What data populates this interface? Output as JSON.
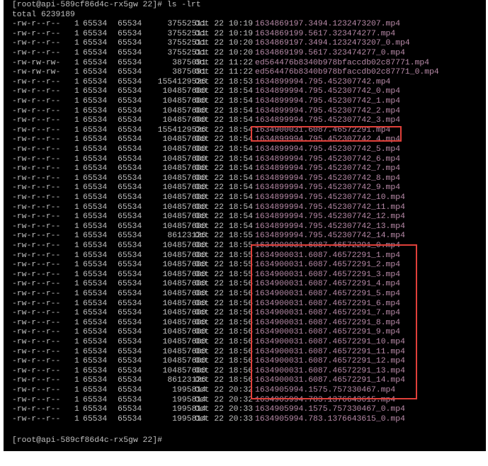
{
  "terminal": {
    "command_prompt": "[root@api-589cf86d4c-rx5gw 22]# ls -lrt",
    "total_line": "total 6239189",
    "entries": [
      {
        "perms": "-rw-r--r--",
        "links": "1",
        "owner": "65534",
        "group": "65534",
        "size": "37552511",
        "date": "Oct 22 10:19",
        "name": "1634869197.3494.1232473207.mp4"
      },
      {
        "perms": "-rw-r--r--",
        "links": "1",
        "owner": "65534",
        "group": "65534",
        "size": "37552511",
        "date": "Oct 22 10:19",
        "name": "1634869199.5617.323474277.mp4"
      },
      {
        "perms": "-rw-r--r--",
        "links": "1",
        "owner": "65534",
        "group": "65534",
        "size": "37552511",
        "date": "Oct 22 10:20",
        "name": "1634869197.3494.1232473207_0.mp4"
      },
      {
        "perms": "-rw-r--r--",
        "links": "1",
        "owner": "65534",
        "group": "65534",
        "size": "37552511",
        "date": "Oct 22 10:20",
        "name": "1634869199.5617.323474277_0.mp4"
      },
      {
        "perms": "-rw-rw-rw-",
        "links": "1",
        "owner": "65534",
        "group": "65534",
        "size": "3875091",
        "date": "Oct 22 11:22",
        "name": "ed564476b8340b978bfaccdb02c87771.mp4"
      },
      {
        "perms": "-rw-rw-rw-",
        "links": "1",
        "owner": "65534",
        "group": "65534",
        "size": "3875091",
        "date": "Oct 22 11:22",
        "name": "ed564476b8340b978bfaccdb02c87771_0.mp4"
      },
      {
        "perms": "-rw-r--r--",
        "links": "1",
        "owner": "65534",
        "group": "65534",
        "size": "1554129526",
        "date": "Oct 22 18:53",
        "name": "1634899994.795.452307742.mp4"
      },
      {
        "perms": "-rw-r--r--",
        "links": "1",
        "owner": "65534",
        "group": "65534",
        "size": "104857600",
        "date": "Oct 22 18:54",
        "name": "1634899994.795.452307742_0.mp4"
      },
      {
        "perms": "-rw-r--r--",
        "links": "1",
        "owner": "65534",
        "group": "65534",
        "size": "104857600",
        "date": "Oct 22 18:54",
        "name": "1634899994.795.452307742_1.mp4"
      },
      {
        "perms": "-rw-r--r--",
        "links": "1",
        "owner": "65534",
        "group": "65534",
        "size": "104857600",
        "date": "Oct 22 18:54",
        "name": "1634899994.795.452307742_2.mp4"
      },
      {
        "perms": "-rw-r--r--",
        "links": "1",
        "owner": "65534",
        "group": "65534",
        "size": "104857600",
        "date": "Oct 22 18:54",
        "name": "1634899994.795.452307742_3.mp4"
      },
      {
        "perms": "-rw-r--r--",
        "links": "1",
        "owner": "65534",
        "group": "65534",
        "size": "1554129526",
        "date": "Oct 22 18:54",
        "name": "1634900031.6087.46572291.mp4"
      },
      {
        "perms": "-rw-r--r--",
        "links": "1",
        "owner": "65534",
        "group": "65534",
        "size": "104857600",
        "date": "Oct 22 18:54",
        "name": "1634899994.795.452307742_4.mp4"
      },
      {
        "perms": "-rw-r--r--",
        "links": "1",
        "owner": "65534",
        "group": "65534",
        "size": "104857600",
        "date": "Oct 22 18:54",
        "name": "1634899994.795.452307742_5.mp4"
      },
      {
        "perms": "-rw-r--r--",
        "links": "1",
        "owner": "65534",
        "group": "65534",
        "size": "104857600",
        "date": "Oct 22 18:54",
        "name": "1634899994.795.452307742_6.mp4"
      },
      {
        "perms": "-rw-r--r--",
        "links": "1",
        "owner": "65534",
        "group": "65534",
        "size": "104857600",
        "date": "Oct 22 18:54",
        "name": "1634899994.795.452307742_7.mp4"
      },
      {
        "perms": "-rw-r--r--",
        "links": "1",
        "owner": "65534",
        "group": "65534",
        "size": "104857600",
        "date": "Oct 22 18:54",
        "name": "1634899994.795.452307742_8.mp4"
      },
      {
        "perms": "-rw-r--r--",
        "links": "1",
        "owner": "65534",
        "group": "65534",
        "size": "104857600",
        "date": "Oct 22 18:54",
        "name": "1634899994.795.452307742_9.mp4"
      },
      {
        "perms": "-rw-r--r--",
        "links": "1",
        "owner": "65534",
        "group": "65534",
        "size": "104857600",
        "date": "Oct 22 18:54",
        "name": "1634899994.795.452307742_10.mp4"
      },
      {
        "perms": "-rw-r--r--",
        "links": "1",
        "owner": "65534",
        "group": "65534",
        "size": "104857600",
        "date": "Oct 22 18:54",
        "name": "1634899994.795.452307742_11.mp4"
      },
      {
        "perms": "-rw-r--r--",
        "links": "1",
        "owner": "65534",
        "group": "65534",
        "size": "104857600",
        "date": "Oct 22 18:54",
        "name": "1634899994.795.452307742_12.mp4"
      },
      {
        "perms": "-rw-r--r--",
        "links": "1",
        "owner": "65534",
        "group": "65534",
        "size": "104857600",
        "date": "Oct 22 18:54",
        "name": "1634899994.795.452307742_13.mp4"
      },
      {
        "perms": "-rw-r--r--",
        "links": "1",
        "owner": "65534",
        "group": "65534",
        "size": "86123126",
        "date": "Oct 22 18:55",
        "name": "1634899994.795.452307742_14.mp4"
      },
      {
        "perms": "-rw-r--r--",
        "links": "1",
        "owner": "65534",
        "group": "65534",
        "size": "104857600",
        "date": "Oct 22 18:55",
        "name": "1634900031.6087.46572291_0.mp4"
      },
      {
        "perms": "-rw-r--r--",
        "links": "1",
        "owner": "65534",
        "group": "65534",
        "size": "104857600",
        "date": "Oct 22 18:55",
        "name": "1634900031.6087.46572291_1.mp4"
      },
      {
        "perms": "-rw-r--r--",
        "links": "1",
        "owner": "65534",
        "group": "65534",
        "size": "104857600",
        "date": "Oct 22 18:55",
        "name": "1634900031.6087.46572291_2.mp4"
      },
      {
        "perms": "-rw-r--r--",
        "links": "1",
        "owner": "65534",
        "group": "65534",
        "size": "104857600",
        "date": "Oct 22 18:55",
        "name": "1634900031.6087.46572291_3.mp4"
      },
      {
        "perms": "-rw-r--r--",
        "links": "1",
        "owner": "65534",
        "group": "65534",
        "size": "104857600",
        "date": "Oct 22 18:56",
        "name": "1634900031.6087.46572291_4.mp4"
      },
      {
        "perms": "-rw-r--r--",
        "links": "1",
        "owner": "65534",
        "group": "65534",
        "size": "104857600",
        "date": "Oct 22 18:56",
        "name": "1634900031.6087.46572291_5.mp4"
      },
      {
        "perms": "-rw-r--r--",
        "links": "1",
        "owner": "65534",
        "group": "65534",
        "size": "104857600",
        "date": "Oct 22 18:56",
        "name": "1634900031.6087.46572291_6.mp4"
      },
      {
        "perms": "-rw-r--r--",
        "links": "1",
        "owner": "65534",
        "group": "65534",
        "size": "104857600",
        "date": "Oct 22 18:56",
        "name": "1634900031.6087.46572291_7.mp4"
      },
      {
        "perms": "-rw-r--r--",
        "links": "1",
        "owner": "65534",
        "group": "65534",
        "size": "104857600",
        "date": "Oct 22 18:56",
        "name": "1634900031.6087.46572291_8.mp4"
      },
      {
        "perms": "-rw-r--r--",
        "links": "1",
        "owner": "65534",
        "group": "65534",
        "size": "104857600",
        "date": "Oct 22 18:56",
        "name": "1634900031.6087.46572291_9.mp4"
      },
      {
        "perms": "-rw-r--r--",
        "links": "1",
        "owner": "65534",
        "group": "65534",
        "size": "104857600",
        "date": "Oct 22 18:56",
        "name": "1634900031.6087.46572291_10.mp4"
      },
      {
        "perms": "-rw-r--r--",
        "links": "1",
        "owner": "65534",
        "group": "65534",
        "size": "104857600",
        "date": "Oct 22 18:56",
        "name": "1634900031.6087.46572291_11.mp4"
      },
      {
        "perms": "-rw-r--r--",
        "links": "1",
        "owner": "65534",
        "group": "65534",
        "size": "104857600",
        "date": "Oct 22 18:56",
        "name": "1634900031.6087.46572291_12.mp4"
      },
      {
        "perms": "-rw-r--r--",
        "links": "1",
        "owner": "65534",
        "group": "65534",
        "size": "104857600",
        "date": "Oct 22 18:56",
        "name": "1634900031.6087.46572291_13.mp4"
      },
      {
        "perms": "-rw-r--r--",
        "links": "1",
        "owner": "65534",
        "group": "65534",
        "size": "86123126",
        "date": "Oct 22 18:56",
        "name": "1634900031.6087.46572291_14.mp4"
      },
      {
        "perms": "-rw-r--r--",
        "links": "1",
        "owner": "65534",
        "group": "65534",
        "size": "1995814",
        "date": "Oct 22 20:32",
        "name": "1634905994.1575.757330467.mp4"
      },
      {
        "perms": "-rw-r--r--",
        "links": "1",
        "owner": "65534",
        "group": "65534",
        "size": "1995814",
        "date": "Oct 22 20:32",
        "name": "1634905994.783.1376643615.mp4"
      },
      {
        "perms": "-rw-r--r--",
        "links": "1",
        "owner": "65534",
        "group": "65534",
        "size": "1995814",
        "date": "Oct 22 20:33",
        "name": "1634905994.1575.757330467_0.mp4"
      },
      {
        "perms": "-rw-r--r--",
        "links": "1",
        "owner": "65534",
        "group": "65534",
        "size": "1995814",
        "date": "Oct 22 20:33",
        "name": "1634905994.783.1376643615_0.mp4"
      }
    ],
    "final_prompt": "[root@api-589cf86d4c-rx5gw 22]#"
  },
  "colors": {
    "background": "#000000",
    "text": "#c0c0c0",
    "filename": "#b88aa8",
    "highlight_border": "#e0403a"
  }
}
